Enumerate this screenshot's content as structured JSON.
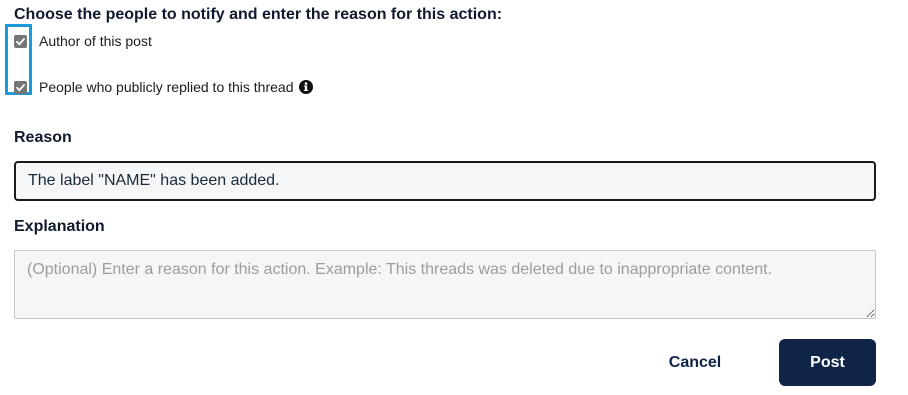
{
  "notify": {
    "heading": "Choose the people to notify and enter the reason for this action:",
    "options": [
      {
        "label": "Author of this post",
        "checked": true
      },
      {
        "label": "People who publicly replied to this thread",
        "checked": true,
        "icon": "info-icon"
      }
    ]
  },
  "reason": {
    "label": "Reason",
    "value": "The label \"NAME\" has been added."
  },
  "explanation": {
    "label": "Explanation",
    "placeholder": "(Optional) Enter a reason for this action. Example: This threads was deleted due to inappropriate content.",
    "value": ""
  },
  "actions": {
    "cancel_label": "Cancel",
    "post_label": "Post"
  },
  "colors": {
    "highlight": "#1a9ad6",
    "primary": "#0f2447",
    "checkbox": "#767676"
  }
}
